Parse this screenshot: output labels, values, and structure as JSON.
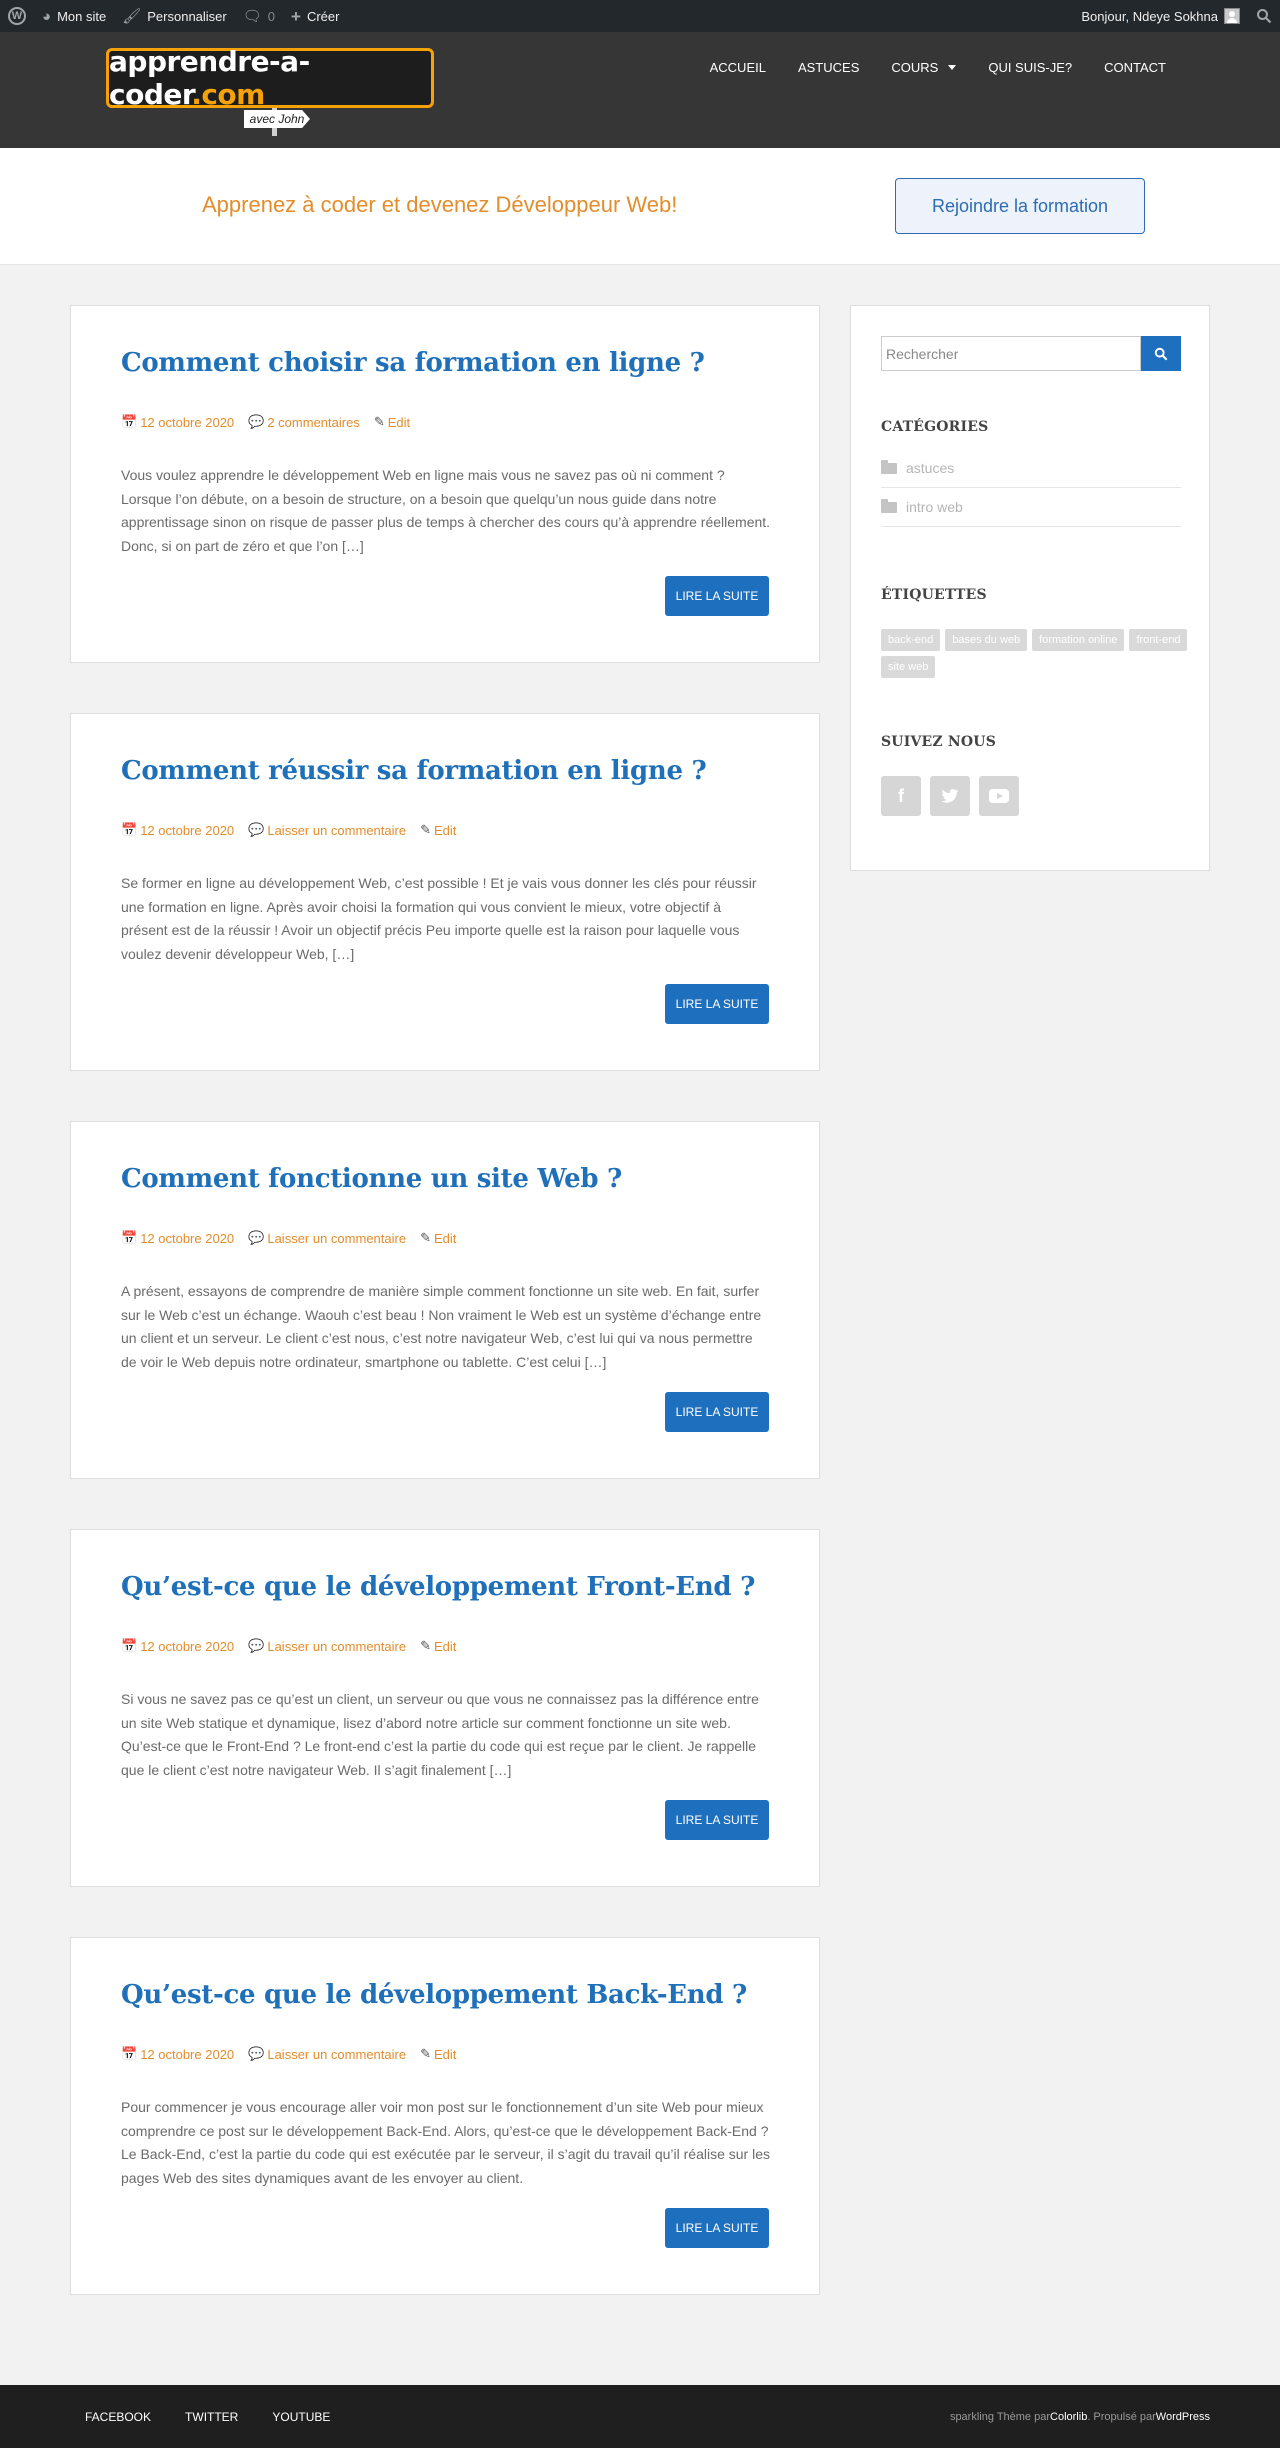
{
  "adminbar": {
    "site_label": "Mon site",
    "customize_label": "Personnaliser",
    "comments_count": "0",
    "create_label": "Créer",
    "greeting": "Bonjour, Ndeye Sokhna"
  },
  "header": {
    "logo_main": "apprendre-a-",
    "logo_mid": "coder",
    "logo_tld": ".com",
    "logo_sign": "avec John",
    "nav": [
      "ACCUEIL",
      "ASTUCES",
      "COURS",
      "QUI SUIS-JE?",
      "CONTACT"
    ]
  },
  "cta": {
    "text": "Apprenez à coder et devenez Développeur Web!",
    "button": "Rejoindre la formation"
  },
  "posts": [
    {
      "title": "Comment choisir sa formation en ligne ?",
      "date": "12 octobre 2020",
      "comments": "2 commentaires",
      "edit": "Edit",
      "excerpt": "Vous voulez apprendre le développement Web en ligne mais vous ne savez pas où ni comment ? Lorsque l’on débute, on a besoin de structure, on a besoin que quelqu’un nous guide dans notre apprentissage sinon on risque de passer plus de temps à chercher des cours qu’à apprendre réellement. Donc, si on part de zéro et que l’on […]",
      "read_more": "LIRE LA SUITE"
    },
    {
      "title": "Comment réussir sa formation en ligne ?",
      "date": "12 octobre 2020",
      "comments": "Laisser un commentaire",
      "edit": "Edit",
      "excerpt": "Se former en ligne au développement Web, c’est possible ! Et je vais vous donner les clés pour réussir une formation en ligne. Après avoir choisi la formation qui vous convient le mieux, votre objectif à présent est de la réussir ! Avoir un objectif précis Peu importe quelle est la raison pour laquelle vous voulez devenir développeur Web, […]",
      "read_more": "LIRE LA SUITE"
    },
    {
      "title": "Comment fonctionne un site Web ?",
      "date": "12 octobre 2020",
      "comments": "Laisser un commentaire",
      "edit": "Edit",
      "excerpt": "A présent, essayons de comprendre de manière simple comment fonctionne un site web. En fait, surfer sur le Web c’est un échange. Waouh c’est beau ! Non vraiment le Web est un système d’échange entre un client et un serveur. Le client c’est nous, c’est notre navigateur Web, c’est lui qui va nous permettre de voir le Web depuis notre ordinateur, smartphone ou tablette. C’est celui […]",
      "read_more": "LIRE LA SUITE"
    },
    {
      "title": "Qu’est-ce que le développement Front-End ?",
      "date": "12 octobre 2020",
      "comments": "Laisser un commentaire",
      "edit": "Edit",
      "excerpt": "Si vous ne savez pas ce qu’est un client, un serveur ou que vous ne connaissez pas la différence entre un site Web statique et dynamique, lisez d’abord notre article sur comment fonctionne un site web. Qu’est-ce que le Front-End ? Le front-end c’est la partie du code qui est reçue par le client. Je rappelle que le client c’est notre navigateur Web. Il s’agit finalement […]",
      "read_more": "LIRE LA SUITE"
    },
    {
      "title": "Qu’est-ce que le développement Back-End ?",
      "date": "12 octobre 2020",
      "comments": "Laisser un commentaire",
      "edit": "Edit",
      "excerpt": "Pour commencer je vous encourage aller voir mon post sur le fonctionnement d’un site Web pour mieux comprendre ce post sur le développement Back-End. Alors, qu’est-ce que le développement Back-End ? Le Back-End, c’est la partie du code qui est exécutée par le serveur, il s’agit du travail qu’il réalise sur les pages Web des sites dynamiques avant de les envoyer au client.",
      "read_more": "LIRE LA SUITE"
    }
  ],
  "sidebar": {
    "search_placeholder": "Rechercher",
    "categories_title": "CATÉGORIES",
    "categories": [
      "astuces",
      "intro web"
    ],
    "tags_title": "ÉTIQUETTES",
    "tags": [
      "back-end",
      "bases du web",
      "formation online",
      "front-end",
      "site web"
    ],
    "follow_title": "SUIVEZ NOUS"
  },
  "footer": {
    "links": [
      "FACEBOOK",
      "TWITTER",
      "YOUTUBE"
    ],
    "credit_prefix": "sparkling Thème par ",
    "credit_theme": "Colorlib",
    "credit_mid": ". Propulsé par ",
    "credit_wp": "WordPress"
  },
  "colors": {
    "accent_orange": "#e38d2c",
    "link_blue": "#1f70b8",
    "button_blue": "#1f6fbf",
    "header_bg": "#363636",
    "adminbar_bg": "#23282d"
  }
}
